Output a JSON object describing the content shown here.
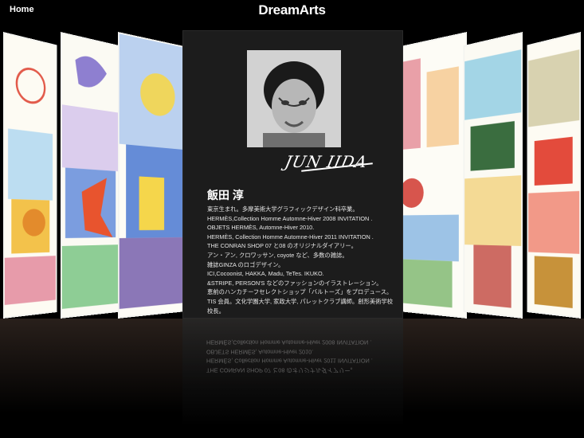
{
  "topbar": {
    "home_label": "Home",
    "logo_text": "DreamArts"
  },
  "profile": {
    "signature": "JUN IIDA",
    "name": "飯田 淳",
    "bio": [
      "東京生まれ。多摩美術大学グラフィックデザイン科卒業。",
      "HERMÈS,Collection Homme Automne-Hiver 2008 INVITATION .",
      "OBJETS HERMÈS, Automne-Hiver 2010.",
      "HERMÈS, Collection Homme Automne-Hiver 2011 INVITATION .",
      "THE CONRAN SHOP 07 と08 のオリジナルダイアリー。",
      "アン・アン, クロワッサン, coyote など、多数の雑誌。",
      "雑誌GINZA のロゴデザイン。",
      "ICI,Cocoonist, HAKKA, Madu, TeTes. IKUKO.",
      "&STRIPE, PERSON'S などのファッションのイラストレーション。",
      "恵前のハンカチーフセレクトショップ「バルトーズ」をプロデュース。",
      "TIS 会員。文化学園大学, 家政大学, パレットクラブ講師。創形美術学校",
      "校長。"
    ]
  },
  "icons": {
    "portrait": "portrait-photo",
    "artwork": "illustration-panel"
  },
  "colors": {
    "background": "#000000",
    "card": "#1c1c1c"
  }
}
